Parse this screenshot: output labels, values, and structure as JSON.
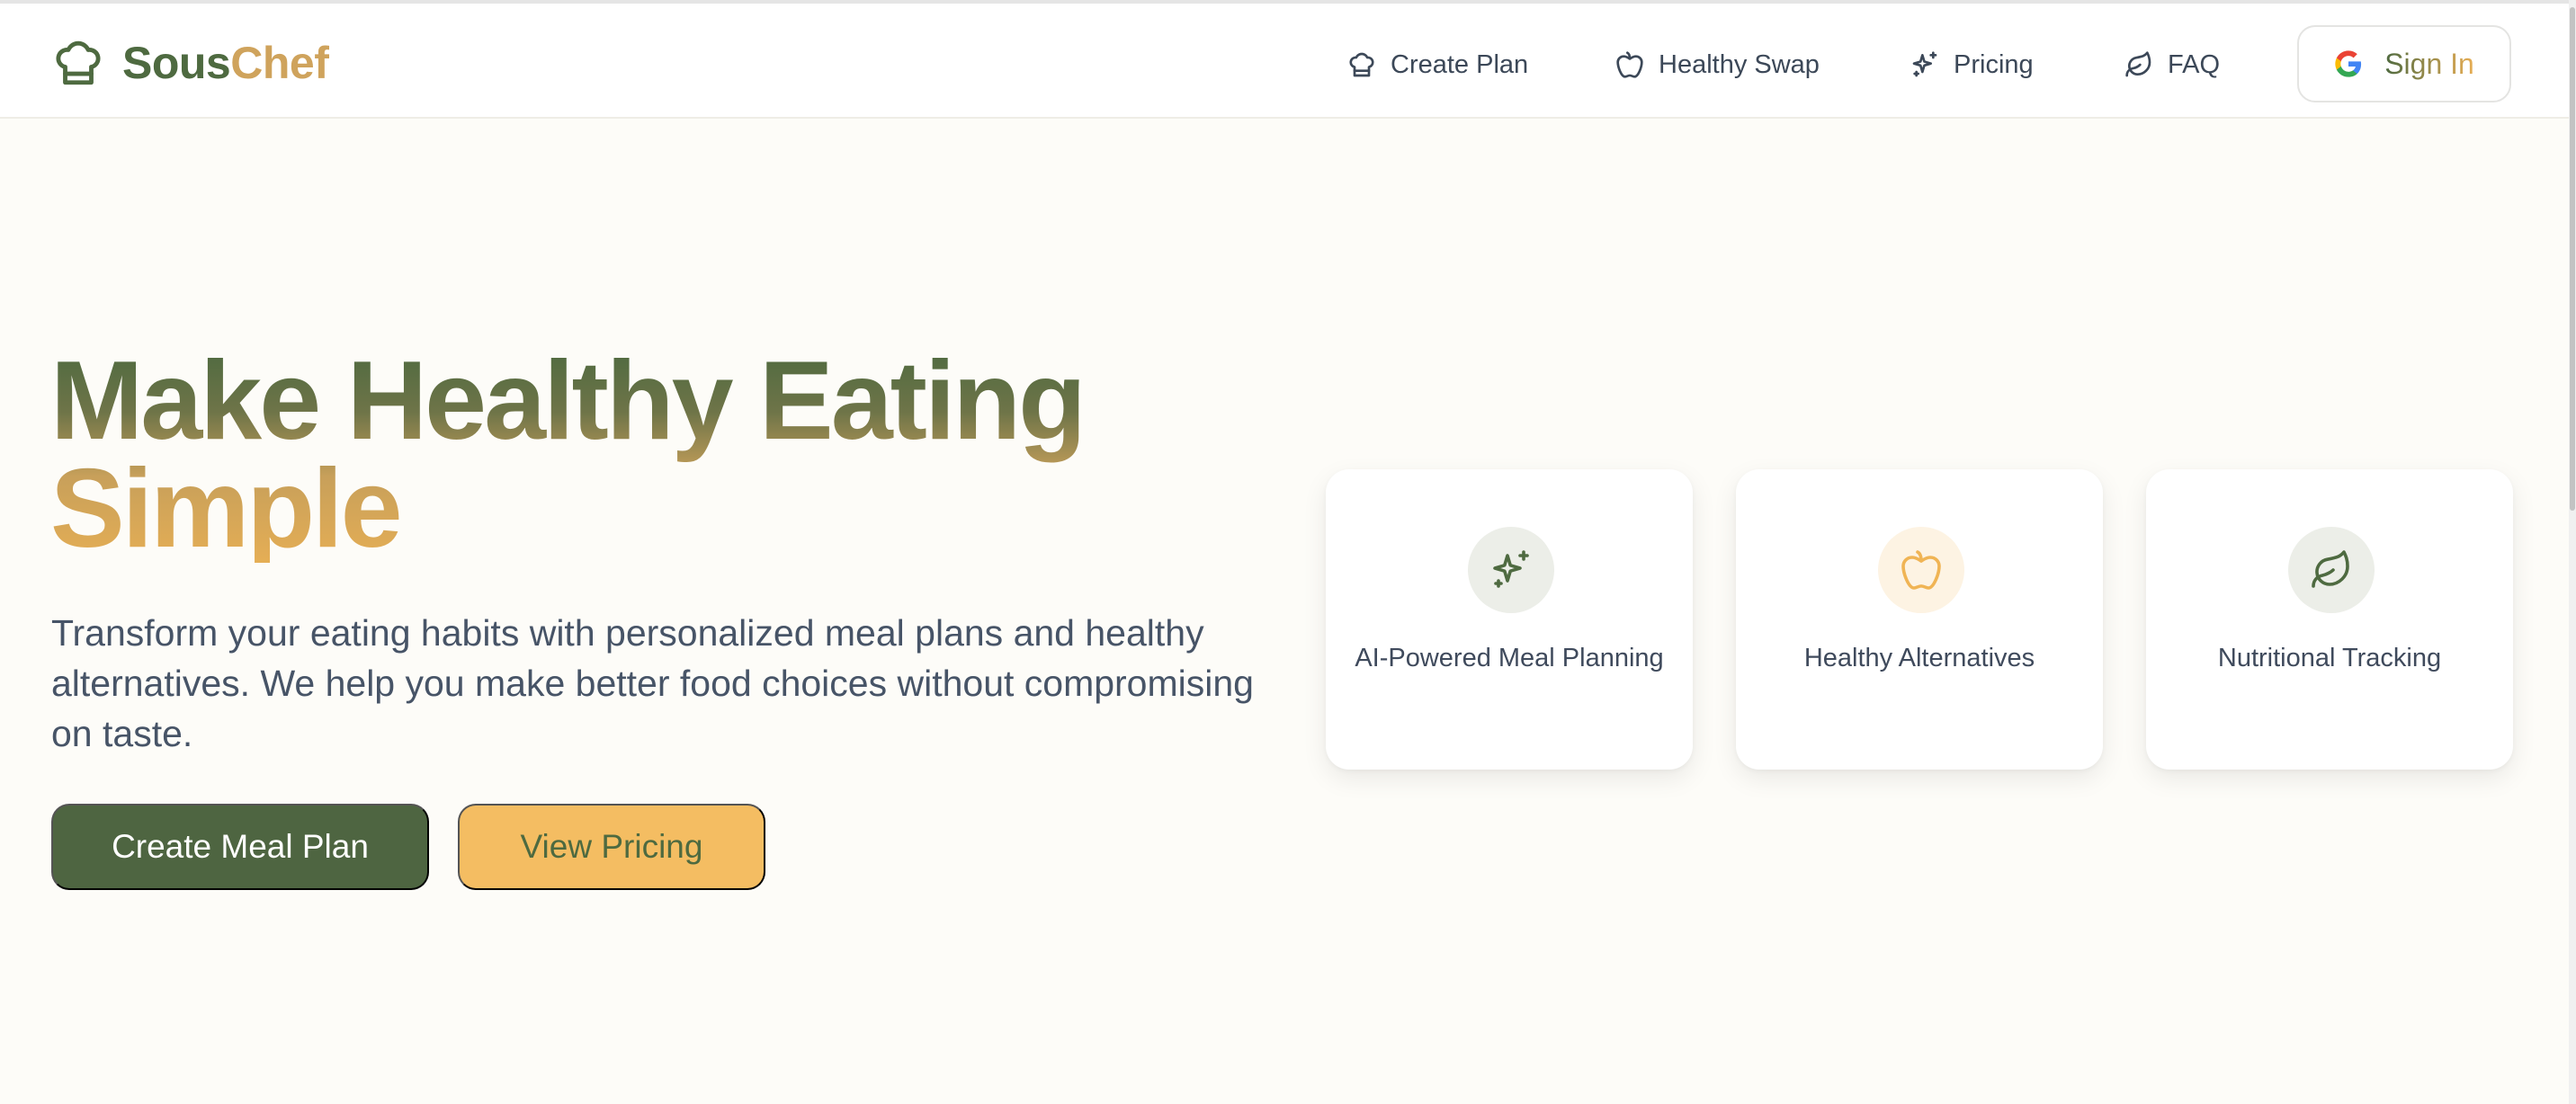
{
  "brand": {
    "name_part1": "Sous",
    "name_part2": "Chef",
    "logo_icon": "chef-hat-icon"
  },
  "nav": {
    "items": [
      {
        "label": "Create Plan",
        "icon": "chef-hat-icon"
      },
      {
        "label": "Healthy Swap",
        "icon": "apple-icon"
      },
      {
        "label": "Pricing",
        "icon": "sparkles-icon"
      },
      {
        "label": "FAQ",
        "icon": "leaf-icon"
      }
    ],
    "signin": {
      "label": "Sign In",
      "icon": "google-icon"
    }
  },
  "hero": {
    "title": "Make Healthy Eating Simple",
    "subtitle": "Transform your eating habits with personalized meal plans and healthy alternatives. We help you make better food choices without compromising on taste.",
    "primary_button": "Create Meal Plan",
    "secondary_button": "View Pricing"
  },
  "features": [
    {
      "label": "AI-Powered Meal Planning",
      "icon": "sparkles-icon"
    },
    {
      "label": "Healthy Alternatives",
      "icon": "apple-icon"
    },
    {
      "label": "Nutritional Tracking",
      "icon": "leaf-icon"
    }
  ],
  "colors": {
    "brand_green": "#4e6541",
    "brand_gold": "#f4bd62",
    "background": "#fdfcf8"
  }
}
